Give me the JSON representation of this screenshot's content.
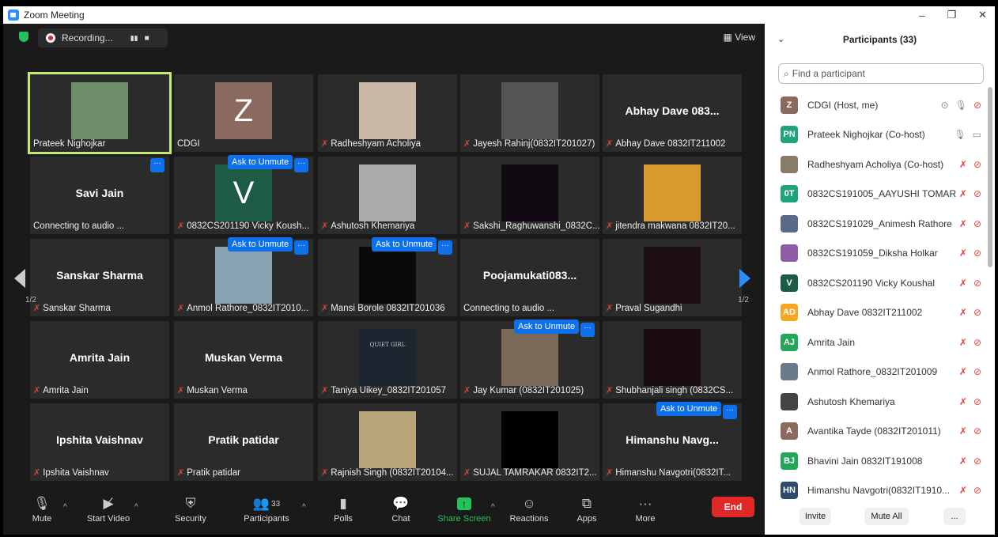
{
  "window": {
    "title": "Zoom Meeting",
    "minimize": "–",
    "restore": "❐",
    "close": "✕"
  },
  "topbar": {
    "recording": "Recording...",
    "pause": "▮▮",
    "stop": "■",
    "view": "View"
  },
  "tiles": [
    {
      "name": "Prateek Nighojkar",
      "muted": false,
      "kind": "photo",
      "color": "#6f8f6a",
      "highlight": true
    },
    {
      "name": "CDGI",
      "muted": false,
      "kind": "letter",
      "letter": "Z",
      "color": "#8a6a5e"
    },
    {
      "name": "Radheshyam Acholiya",
      "muted": true,
      "kind": "photo",
      "color": "#c9b9a6"
    },
    {
      "name": "Jayesh Rahinj(0832IT201027)",
      "muted": true,
      "kind": "photo",
      "color": "#555"
    },
    {
      "name": "Abhay Dave 0832IT211002",
      "muted": true,
      "kind": "big",
      "big": "Abhay Dave 083..."
    },
    {
      "name": "Connecting to audio ...",
      "muted": false,
      "kind": "big",
      "big": "Savi Jain"
    },
    {
      "name": "0832CS201190 Vicky Koush...",
      "muted": true,
      "kind": "letter",
      "letter": "V",
      "color": "#1d5b45",
      "ask": true
    },
    {
      "name": "Ashutosh Khemariya",
      "muted": true,
      "kind": "photo",
      "color": "#aaa"
    },
    {
      "name": "Sakshi_Raghuwanshi_0832C...",
      "muted": true,
      "kind": "dark",
      "color": "#120a12"
    },
    {
      "name": "jitendra makwana 0832IT20...",
      "muted": true,
      "kind": "photo",
      "color": "#d79b2e"
    },
    {
      "name": "Sanskar Sharma",
      "muted": true,
      "kind": "big",
      "big": "Sanskar Sharma"
    },
    {
      "name": "Anmol Rathore_0832IT2010...",
      "muted": true,
      "kind": "photo",
      "color": "#8aa3b3",
      "ask": true
    },
    {
      "name": "Mansi Borole 0832IT201036",
      "muted": true,
      "kind": "dark",
      "color": "#0a0a0a",
      "ask": true
    },
    {
      "name": "Connecting to audio ...",
      "muted": false,
      "kind": "big",
      "big": "Poojamukati083..."
    },
    {
      "name": "Praval Sugandhi",
      "muted": true,
      "kind": "dark",
      "color": "#1e0f16"
    },
    {
      "name": "Amrita Jain",
      "muted": true,
      "kind": "big",
      "big": "Amrita Jain"
    },
    {
      "name": "Muskan Verma",
      "muted": true,
      "kind": "big",
      "big": "Muskan Verma"
    },
    {
      "name": "Taniya Uikey_0832IT201057",
      "muted": true,
      "kind": "dark",
      "color": "#1d2630",
      "art": "QUIET GIRL"
    },
    {
      "name": "Jay Kumar (0832IT201025)",
      "muted": true,
      "kind": "photo",
      "color": "#7b6a58",
      "ask": true
    },
    {
      "name": "Shubhanjali singh (0832CS...",
      "muted": true,
      "kind": "dark",
      "color": "#1a0b10"
    },
    {
      "name": "Ipshita Vaishnav",
      "muted": true,
      "kind": "big",
      "big": "Ipshita Vaishnav"
    },
    {
      "name": "Pratik patidar",
      "muted": true,
      "kind": "big",
      "big": "Pratik patidar"
    },
    {
      "name": "Rajnish Singh (0832IT20104...",
      "muted": true,
      "kind": "photo",
      "color": "#b8a67a"
    },
    {
      "name": "SUJAL TAMRAKAR 0832IT2...",
      "muted": true,
      "kind": "dark",
      "color": "#000"
    },
    {
      "name": "Himanshu Navgotri(0832IT...",
      "muted": true,
      "kind": "big",
      "big": "Himanshu  Navg...",
      "ask": true
    }
  ],
  "ask_label": "Ask to Unmute",
  "dots_label": "···",
  "pager": {
    "left": "1/2",
    "right": "1/2"
  },
  "toolbar": {
    "mute": "Mute",
    "video": "Start Video",
    "security": "Security",
    "participants": "Participants",
    "participants_count": "33",
    "polls": "Polls",
    "chat": "Chat",
    "share": "Share Screen",
    "reactions": "Reactions",
    "apps": "Apps",
    "more": "More",
    "end": "End"
  },
  "panel": {
    "title": "Participants (33)",
    "search_placeholder": "Find a participant",
    "invite": "Invite",
    "mute_all": "Mute All",
    "more": "...",
    "participants": [
      {
        "initials": "Z",
        "name": "CDGI (Host, me)",
        "color": "#8a6a5e",
        "muted": false
      },
      {
        "initials": "PN",
        "name": "Prateek Nighojkar (Co-host)",
        "color": "#1fa37a",
        "muted": false
      },
      {
        "initials": "",
        "name": "Radheshyam Acholiya (Co-host)",
        "color": "#8a7a6a",
        "muted": true
      },
      {
        "initials": "0T",
        "name": "0832CS191005_AAYUSHI TOMAR",
        "color": "#1fa37a",
        "muted": true
      },
      {
        "initials": "",
        "name": "0832CS191029_Animesh Rathore",
        "color": "#5a6b8a",
        "muted": true
      },
      {
        "initials": "",
        "name": "0832CS191059_Diksha Holkar",
        "color": "#8e5ea8",
        "muted": true
      },
      {
        "initials": "V",
        "name": "0832CS201190 Vicky Koushal",
        "color": "#1d5b45",
        "muted": true
      },
      {
        "initials": "AD",
        "name": "Abhay Dave 0832IT211002",
        "color": "#f5a623",
        "muted": true
      },
      {
        "initials": "AJ",
        "name": "Amrita Jain",
        "color": "#23a55a",
        "muted": true
      },
      {
        "initials": "",
        "name": "Anmol Rathore_0832IT201009",
        "color": "#6a7a8a",
        "muted": true
      },
      {
        "initials": "",
        "name": "Ashutosh Khemariya",
        "color": "#444",
        "muted": true
      },
      {
        "initials": "A",
        "name": "Avantika Tayde (0832IT201011)",
        "color": "#8a6a5e",
        "muted": true
      },
      {
        "initials": "BJ",
        "name": "Bhavini Jain 0832IT191008",
        "color": "#23a55a",
        "muted": true
      },
      {
        "initials": "HN",
        "name": "Himanshu Navgotri(0832IT1910...",
        "color": "#2d4b6b",
        "muted": true
      }
    ]
  }
}
